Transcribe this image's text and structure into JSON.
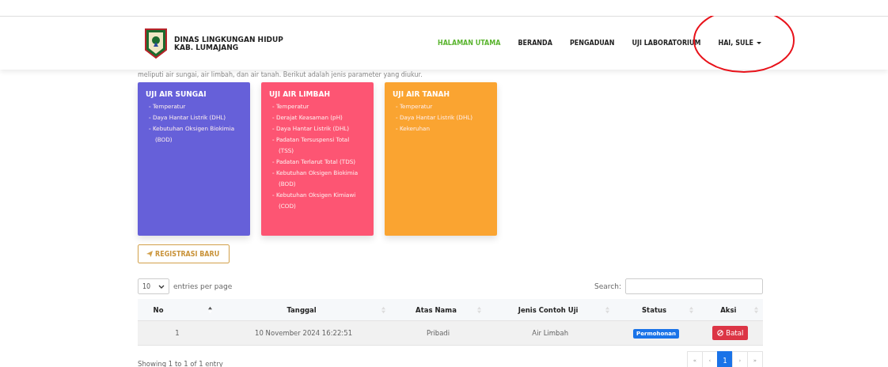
{
  "header": {
    "brand": [
      "DINAS LINGKUNGAN HIDUP",
      "KAB. LUMAJANG"
    ],
    "nav": [
      {
        "label": "HALAMAN UTAMA",
        "selected": true
      },
      {
        "label": "BERANDA",
        "selected": false
      },
      {
        "label": "PENGADUAN",
        "selected": false
      },
      {
        "label": "UJI LABORATORIUM",
        "selected": false
      }
    ],
    "user_menu": "HAI, SULE"
  },
  "intro": "meliputi air sungai, air limbah, dan air tanah. Berikut adalah jenis parameter yang diukur.",
  "cards": [
    {
      "title": "UJI AIR SUNGAI",
      "color": "#6660d9",
      "items": [
        "- Temperatur",
        "- Daya Hantar Listrik (DHL)",
        "- Kebutuhan Oksigen Biokimia (BOD)"
      ]
    },
    {
      "title": "UJI AIR LIMBAH",
      "color": "#fd5573",
      "items": [
        "- Temperatur",
        "- Derajat Keasaman (pH)",
        "- Daya Hantar Listrik (DHL)",
        "- Padatan Tersuspensi Total (TSS)",
        "- Padatan Terlarut Total (TDS)",
        "- Kebutuhan Oksigen Biokimia (BOD)",
        "- Kebutuhan Oksigen Kimiawi (COD)"
      ]
    },
    {
      "title": "UJI AIR TANAH",
      "color": "#faa431",
      "items": [
        "- Temperatur",
        "- Daya Hantar Listrik (DHL)",
        "- Kekeruhan"
      ]
    }
  ],
  "register_button": "REGISTRASI BARU",
  "table": {
    "page_size": "10",
    "page_size_label": "entries per page",
    "search_label": "Search:",
    "columns": [
      {
        "label": "No",
        "sorted": true
      },
      {
        "label": "Tanggal",
        "sorted": false
      },
      {
        "label": "Atas Nama",
        "sorted": false
      },
      {
        "label": "Jenis Contoh Uji",
        "sorted": false
      },
      {
        "label": "Status",
        "sorted": false
      },
      {
        "label": "Aksi",
        "sorted": false
      }
    ],
    "rows": [
      {
        "no": "1",
        "date": "10 November 2024 16:22:51",
        "name": "Pribadi",
        "sample": "Air Limbah",
        "status": "Permohonan",
        "action": "Batal"
      }
    ],
    "info": "Showing 1 to 1 of 1 entry",
    "pagination": [
      {
        "label": "«",
        "selected": false
      },
      {
        "label": "‹",
        "selected": false
      },
      {
        "label": "1",
        "selected": true
      },
      {
        "label": "›",
        "selected": false
      },
      {
        "label": "»",
        "selected": false
      }
    ]
  }
}
